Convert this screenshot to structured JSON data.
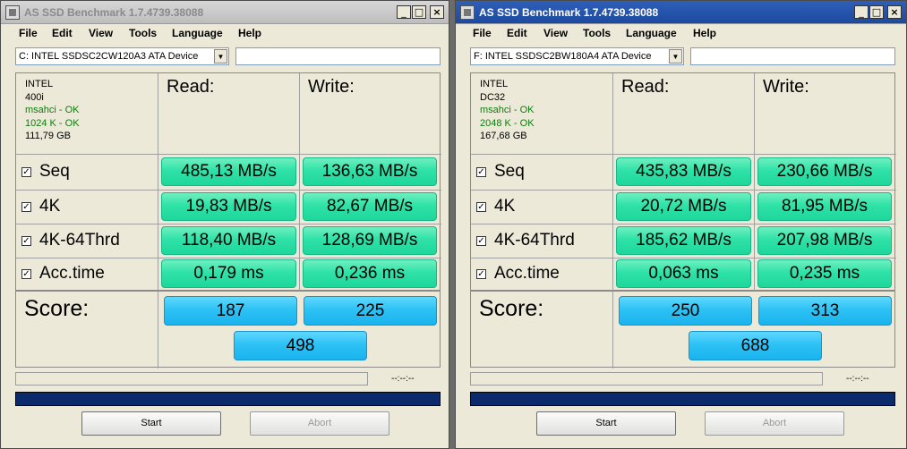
{
  "windows": [
    {
      "title": "AS SSD Benchmark 1.7.4739.38088",
      "menu": [
        "File",
        "Edit",
        "View",
        "Tools",
        "Language",
        "Help"
      ],
      "drive": "C: INTEL SSDSC2CW120A3 ATA Device",
      "info": {
        "vendor": "INTEL",
        "model": "400i",
        "driver": "msahci - OK",
        "alignment": "1024 K - OK",
        "size": "111,79 GB"
      },
      "headers": {
        "read": "Read:",
        "write": "Write:"
      },
      "rows": [
        {
          "label": "Seq",
          "read": "485,13 MB/s",
          "write": "136,63 MB/s"
        },
        {
          "label": "4K",
          "read": "19,83 MB/s",
          "write": "82,67 MB/s"
        },
        {
          "label": "4K-64Thrd",
          "read": "118,40 MB/s",
          "write": "128,69 MB/s"
        },
        {
          "label": "Acc.time",
          "read": "0,179 ms",
          "write": "0,236 ms"
        }
      ],
      "score": {
        "label": "Score:",
        "read": "187",
        "write": "225",
        "total": "498"
      },
      "time": "--:--:--",
      "buttons": {
        "start": "Start",
        "abort": "Abort"
      }
    },
    {
      "title": "AS SSD Benchmark 1.7.4739.38088",
      "menu": [
        "File",
        "Edit",
        "View",
        "Tools",
        "Language",
        "Help"
      ],
      "drive": "F: INTEL SSDSC2BW180A4 ATA Device",
      "info": {
        "vendor": "INTEL",
        "model": "DC32",
        "driver": "msahci - OK",
        "alignment": "2048 K - OK",
        "size": "167,68 GB"
      },
      "headers": {
        "read": "Read:",
        "write": "Write:"
      },
      "rows": [
        {
          "label": "Seq",
          "read": "435,83 MB/s",
          "write": "230,66 MB/s"
        },
        {
          "label": "4K",
          "read": "20,72 MB/s",
          "write": "81,95 MB/s"
        },
        {
          "label": "4K-64Thrd",
          "read": "185,62 MB/s",
          "write": "207,98 MB/s"
        },
        {
          "label": "Acc.time",
          "read": "0,063 ms",
          "write": "0,235 ms"
        }
      ],
      "score": {
        "label": "Score:",
        "read": "250",
        "write": "313",
        "total": "688"
      },
      "time": "--:--:--",
      "buttons": {
        "start": "Start",
        "abort": "Abort"
      }
    }
  ],
  "colors": {
    "result_green": "#2fe2a8",
    "score_blue": "#2ec2f5",
    "progress_navy": "#0a2a6b",
    "ok_green": "#0e7d0e",
    "active_title": "#2e5fb8"
  },
  "icons": {
    "checkbox": "checkbox-checked-icon",
    "dropdown": "chevron-down-icon",
    "minimize": "minimize-icon",
    "maximize": "maximize-icon",
    "close": "close-icon"
  }
}
